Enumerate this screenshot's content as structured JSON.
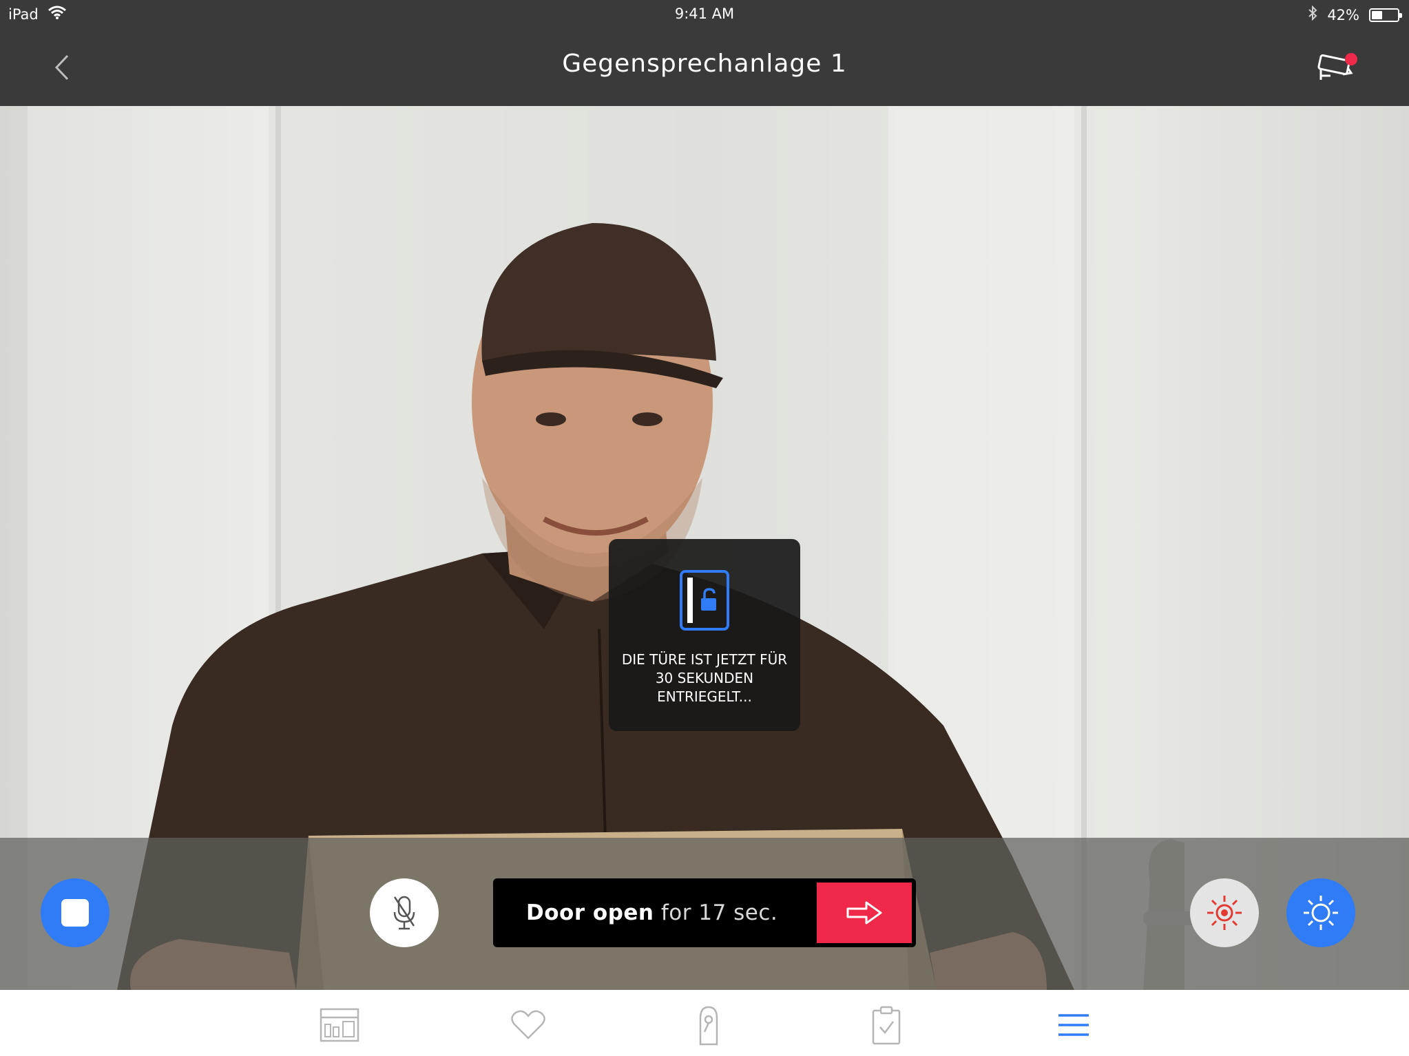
{
  "status_bar": {
    "device": "iPad",
    "time": "9:41 AM",
    "battery": "42%",
    "battery_level": 0.42
  },
  "navbar": {
    "title": "Gegensprechanlage 1",
    "back_icon": "chevron-left-icon",
    "camera_icon": "security-camera-icon",
    "notification_color": "#f0284a"
  },
  "toast": {
    "icon": "door-unlocked-icon",
    "line1": "DIE TÜRE IST JETZT FÜR",
    "line2": "30 SEKUNDEN",
    "line3": "ENTRIEGELT..."
  },
  "controls": {
    "door_label_bold": "Door open",
    "door_label_rest": " for 17 sec.",
    "open_icon": "arrow-right-icon",
    "stop_icon": "stop-icon",
    "mic_icon": "microphone-muted-icon",
    "light_icon": "light-icon",
    "brightness_icon": "brightness-icon"
  },
  "tabs": [
    {
      "name": "dashboard",
      "icon": "dashboard-icon"
    },
    {
      "name": "favorites",
      "icon": "heart-icon"
    },
    {
      "name": "doors",
      "icon": "door-handle-icon"
    },
    {
      "name": "tasks",
      "icon": "clipboard-check-icon"
    },
    {
      "name": "menu",
      "icon": "menu-icon",
      "active": true
    }
  ],
  "colors": {
    "accent_blue": "#2f7cf6",
    "alert_red": "#f0284a",
    "bar_dark": "#3a3a3a"
  }
}
